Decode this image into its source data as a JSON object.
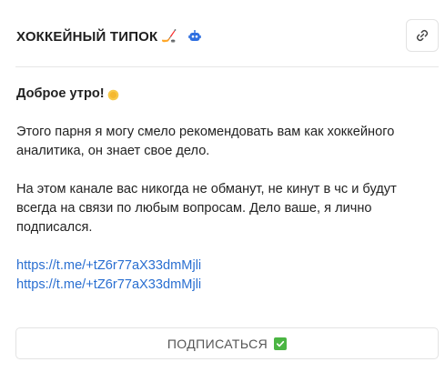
{
  "header": {
    "title": "ХОККЕЙНЫЙ ТИПОК",
    "title_emoji": "🏒",
    "bot_icon": "bot-icon",
    "link_button_icon": "link-icon"
  },
  "post": {
    "greeting": "Доброе утро!",
    "greeting_icon": "sun-icon",
    "paragraph_1": "Этого парня я могу смело рекомендовать вам как хоккейного аналитика, он знает свое дело.",
    "paragraph_2": "На этом канале вас никогда не обманут, не кинут в чс и будут всегда на связи по любым вопросам. Дело ваше, я лично подписался.",
    "links": [
      "https://t.me/+tZ6r77aX33dmMjli",
      "https://t.me/+tZ6r77aX33dmMjli"
    ]
  },
  "subscribe": {
    "label": "ПОДПИСАТЬСЯ",
    "icon": "check-icon"
  },
  "colors": {
    "link": "#2a6fd1",
    "check": "#4bb543",
    "sun": "#f5b82e",
    "bot": "#2f6fe0"
  }
}
